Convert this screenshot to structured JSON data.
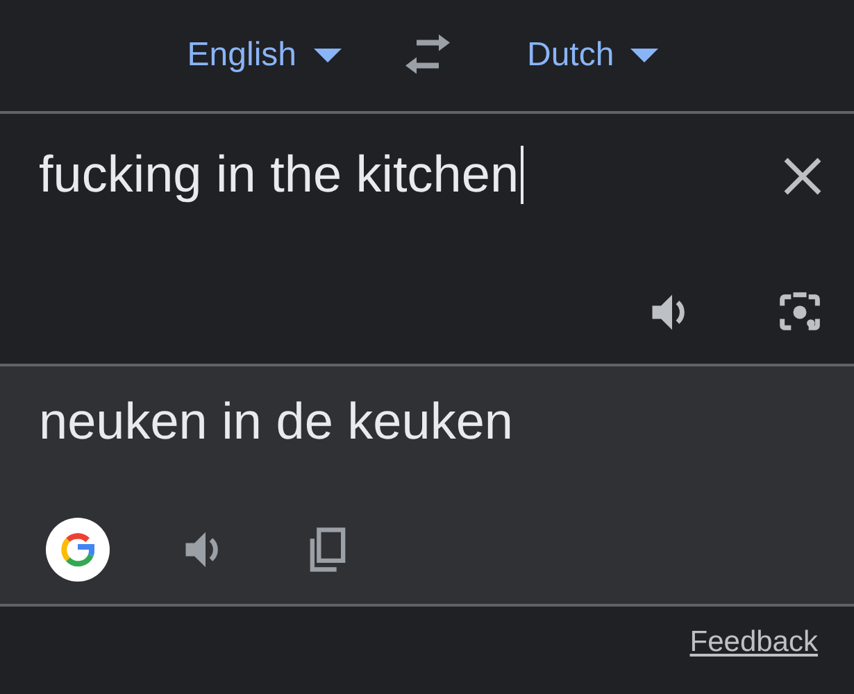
{
  "languages": {
    "source": "English",
    "target": "Dutch"
  },
  "input": {
    "value": "fucking in the kitchen"
  },
  "output": {
    "text": "neuken in de keuken"
  },
  "footer": {
    "link": "Feedback"
  }
}
